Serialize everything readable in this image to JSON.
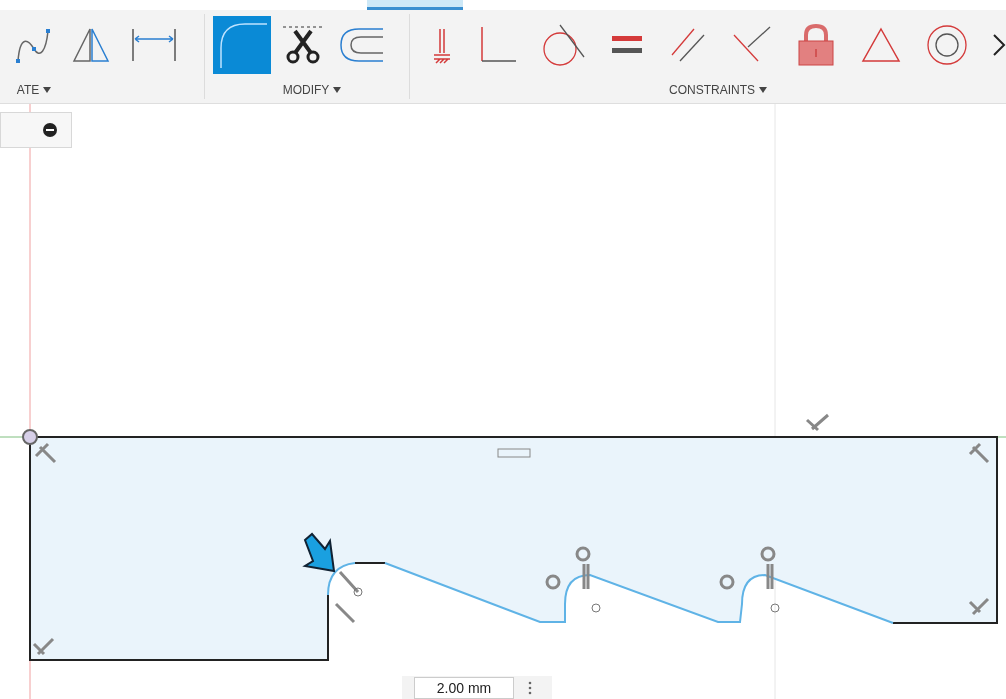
{
  "toolbar": {
    "groups": [
      {
        "label": "ATE",
        "tools": [
          {
            "kind": "spline",
            "selected": false
          },
          {
            "kind": "mirror",
            "selected": false
          },
          {
            "kind": "dimension",
            "selected": false
          }
        ]
      },
      {
        "label": "MODIFY",
        "tools": [
          {
            "kind": "fillet",
            "selected": true
          },
          {
            "kind": "trim",
            "selected": false
          },
          {
            "kind": "offset",
            "selected": false
          }
        ]
      },
      {
        "label": "CONSTRAINTS",
        "tools": [
          {
            "kind": "fix",
            "selected": false
          },
          {
            "kind": "perpendicular",
            "selected": false
          },
          {
            "kind": "tangent",
            "selected": false
          },
          {
            "kind": "equal",
            "selected": false
          },
          {
            "kind": "parallel",
            "selected": false
          },
          {
            "kind": "angle",
            "selected": false
          },
          {
            "kind": "lock",
            "selected": false
          },
          {
            "kind": "triangle",
            "selected": false
          },
          {
            "kind": "concentric",
            "selected": false
          },
          {
            "kind": "more",
            "selected": false
          }
        ]
      }
    ]
  },
  "dimension_input": {
    "value": "2.00 mm"
  }
}
